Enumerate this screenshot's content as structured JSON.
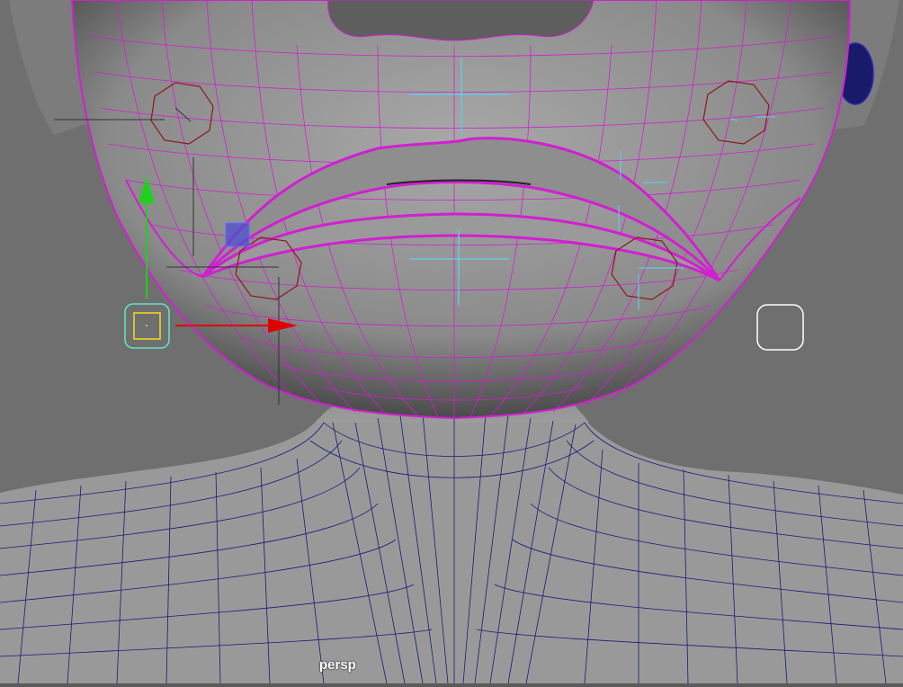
{
  "viewport": {
    "camera_label": "persp"
  },
  "colors": {
    "background": "#6f6f6f",
    "wireframe_selected": "#d21fd2",
    "wireframe_body": "#1a1a7a",
    "axis_x": "#e00000",
    "axis_y": "#20d020",
    "control_cyan": "#66c8e0",
    "control_red": "#8b1a1a"
  },
  "icons": {
    "move_tool": "move-manipulator-icon",
    "control": "nurbs-circle-control-icon"
  }
}
